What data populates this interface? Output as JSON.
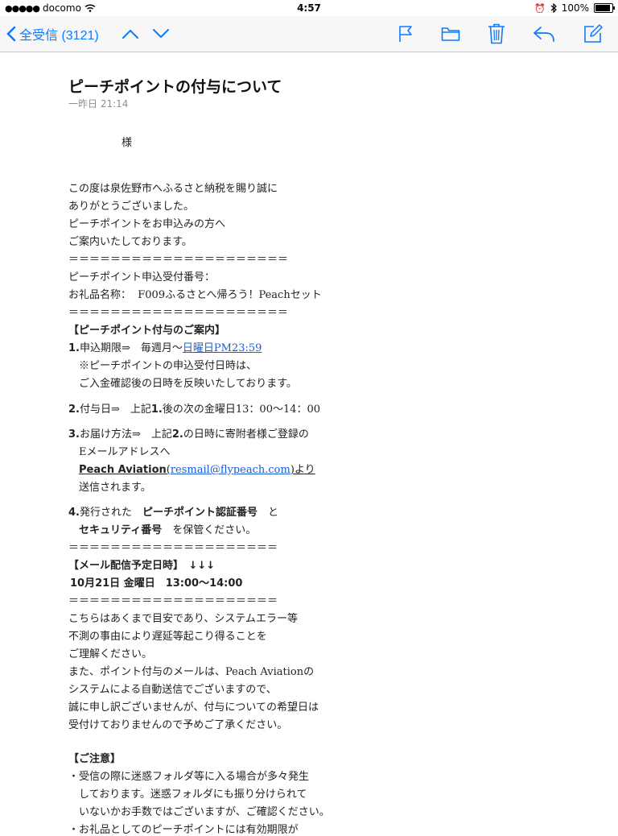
{
  "status": {
    "carrier": "docomo",
    "time": "4:57",
    "battery": "100%",
    "battery_level": 1.0
  },
  "navbar": {
    "back_label": "全受信 (3121)"
  },
  "email": {
    "subject": "ピーチポイントの付与について",
    "date": "一昨日 21:14",
    "body": {
      "salutation": "様",
      "p1_l1": "この度は泉佐野市へふるさと納税を賜り誠に",
      "p1_l2": "ありがとうございました。",
      "p1_l3": "ピーチポイントをお申込みの方へ",
      "p1_l4": "ご案内いたしております。",
      "sep": "＝＝＝＝＝＝＝＝＝＝＝＝＝＝＝＝＝＝＝＝＝",
      "sep_short": "＝＝＝＝＝＝＝＝＝＝＝＝＝＝＝＝＝＝＝＝",
      "app_no": "ピーチポイント申込受付番号：",
      "gift": "お礼品名称：  F009ふるさとへ帰ろう！Peachセット",
      "info_header": "【ピーチポイント付与のご案内】",
      "s1_num": "1.",
      "s1_text": "申込期限⇒　毎週月〜",
      "s1_link": "日曜日PM23:59",
      "s1_note1": "※ピーチポイントの申込受付日時は、",
      "s1_note2": "ご入金確認後の日時を反映いたしております。",
      "s2_num": "2.",
      "s2_text_a": "付与日⇒　上記",
      "s2_text_b": "1.",
      "s2_text_c": "後の次の金曜日13：00〜14：00",
      "s3_num": "3.",
      "s3_text_a": "お届け方法⇒　上記",
      "s3_text_b": "2.",
      "s3_text_c": "の日時に寄附者様ご登録の",
      "s3_l2": "Eメールアドレスへ",
      "s3_sender": "Peach Aviation",
      "s3_email": "resmail@flypeach.com",
      "s3_from_a": "(",
      "s3_from_b": ")より",
      "s3_l4": "送信されます。",
      "s4_num": "4.",
      "s4_text_a": "発行された　",
      "s4_text_b": "ピーチポイント認証番号",
      "s4_text_c": "　と",
      "s4_l2_a": "セキュリティ番号",
      "s4_l2_b": "　を保管ください。",
      "mail_header": "【メール配信予定日時】　↓↓↓",
      "mail_date": "10月21日 金曜日　13:00〜14:00",
      "n1": "こちらはあくまで目安であり、システムエラー等",
      "n2": "不測の事由により遅延等起こり得ることを",
      "n3": "ご理解ください。",
      "n4": "また、ポイント付与のメールは、Peach Aviationの",
      "n5": "システムによる自動送信でございますので、",
      "n6": "誠に申し訳ございませんが、付与についての希望日は",
      "n7": "受付けておりませんので予めご了承ください。",
      "caution_header": "【ご注意】",
      "c1": "・受信の際に迷惑フォルダ等に入る場合が多々発生",
      "c2": "　しております。迷惑フォルダにも振り分けられて",
      "c3": "　いないかお手数ではございますが、ご確認ください。",
      "c4": "・お礼品としてのピーチポイントには有効期限が"
    }
  },
  "colors": {
    "accent": "#0a7aff",
    "link": "#1a5cd0"
  }
}
